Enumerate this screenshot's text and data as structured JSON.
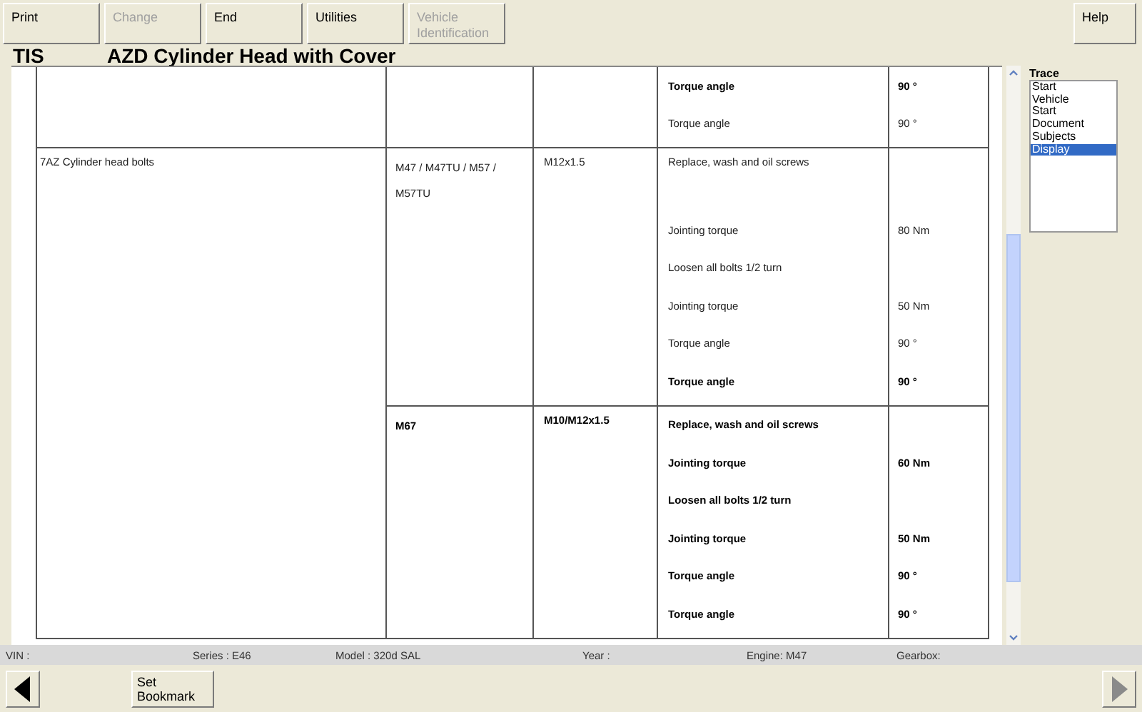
{
  "toolbar": [
    {
      "label": "Print",
      "disabled": false
    },
    {
      "label": "Change",
      "disabled": true
    },
    {
      "label": "End",
      "disabled": false
    },
    {
      "label": "Utilities",
      "disabled": false
    },
    {
      "label": "Vehicle Identification",
      "disabled": true
    }
  ],
  "help": {
    "label": "Help",
    "disabled": false
  },
  "header": {
    "app": "TIS",
    "title": "AZD  Cylinder Head with Cover"
  },
  "sections": [
    {
      "subrows": [
        {
          "steps": [
            {
              "text": "Torque angle",
              "value": "90 °",
              "bold": true
            },
            {
              "text": "Torque angle",
              "value": "90 °",
              "bold": false
            }
          ]
        }
      ]
    },
    {
      "part": "7AZ  Cylinder head bolts",
      "subrows": [
        {
          "engine": "M47 / M47TU / M57 / M57TU",
          "thread": "M12x1.5",
          "bold": false,
          "steps": [
            {
              "text": "Replace, wash and oil screws",
              "bold": false,
              "tall": true
            },
            {
              "text": "Jointing torque",
              "value": "80 Nm",
              "bold": false
            },
            {
              "text": "Loosen all bolts 1/2 turn",
              "bold": false
            },
            {
              "text": "Jointing torque",
              "value": "50 Nm",
              "bold": false
            },
            {
              "text": "Torque angle",
              "value": "90 °",
              "bold": false
            },
            {
              "text": "Torque angle",
              "value": "90 °",
              "bold": true
            }
          ]
        },
        {
          "engine": "M67",
          "thread": "M10/M12x1.5",
          "bold": true,
          "steps": [
            {
              "text": "Replace, wash and oil screws",
              "bold": true
            },
            {
              "text": "Jointing torque",
              "value": "60 Nm",
              "bold": true
            },
            {
              "text": "Loosen all bolts 1/2 turn",
              "bold": true
            },
            {
              "text": "Jointing torque",
              "value": "50 Nm",
              "bold": true
            },
            {
              "text": "Torque angle",
              "value": "90 °",
              "bold": true
            },
            {
              "text": "Torque angle",
              "value": "90 °",
              "bold": true
            }
          ]
        }
      ]
    }
  ],
  "trace": {
    "title": "Trace",
    "items": [
      {
        "label": "Start",
        "selected": false
      },
      {
        "label": "Vehicle",
        "selected": false
      },
      {
        "label": "Start",
        "selected": false
      },
      {
        "label": "Document",
        "selected": false
      },
      {
        "label": "Subjects",
        "selected": false
      },
      {
        "label": "Display",
        "selected": true
      }
    ]
  },
  "status_bar": [
    "VIN :",
    "Series : E46",
    "Model : 320d SAL",
    "Year :",
    "Engine: M47",
    "Gearbox:"
  ],
  "nav": {
    "back_disabled": false,
    "bookmark": "Set Bookmark",
    "forward_disabled": true
  }
}
